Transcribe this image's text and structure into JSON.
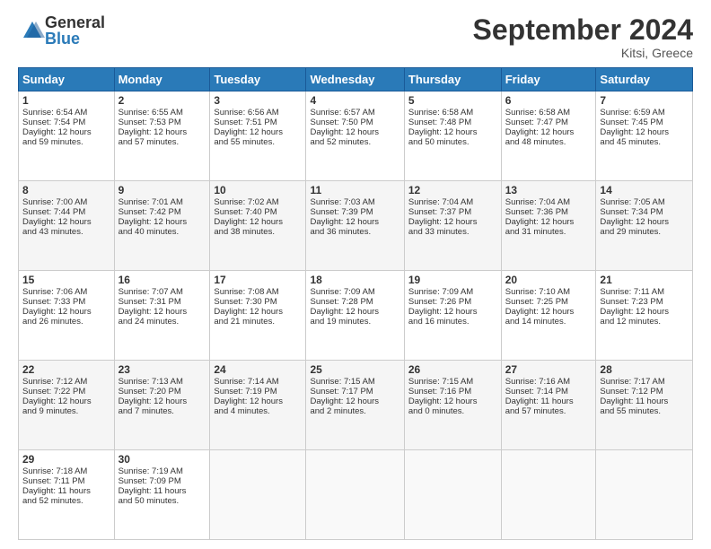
{
  "header": {
    "logo_general": "General",
    "logo_blue": "Blue",
    "month_title": "September 2024",
    "location": "Kitsi, Greece"
  },
  "days_of_week": [
    "Sunday",
    "Monday",
    "Tuesday",
    "Wednesday",
    "Thursday",
    "Friday",
    "Saturday"
  ],
  "weeks": [
    [
      {
        "day": "1",
        "lines": [
          "Sunrise: 6:54 AM",
          "Sunset: 7:54 PM",
          "Daylight: 12 hours",
          "and 59 minutes."
        ]
      },
      {
        "day": "2",
        "lines": [
          "Sunrise: 6:55 AM",
          "Sunset: 7:53 PM",
          "Daylight: 12 hours",
          "and 57 minutes."
        ]
      },
      {
        "day": "3",
        "lines": [
          "Sunrise: 6:56 AM",
          "Sunset: 7:51 PM",
          "Daylight: 12 hours",
          "and 55 minutes."
        ]
      },
      {
        "day": "4",
        "lines": [
          "Sunrise: 6:57 AM",
          "Sunset: 7:50 PM",
          "Daylight: 12 hours",
          "and 52 minutes."
        ]
      },
      {
        "day": "5",
        "lines": [
          "Sunrise: 6:58 AM",
          "Sunset: 7:48 PM",
          "Daylight: 12 hours",
          "and 50 minutes."
        ]
      },
      {
        "day": "6",
        "lines": [
          "Sunrise: 6:58 AM",
          "Sunset: 7:47 PM",
          "Daylight: 12 hours",
          "and 48 minutes."
        ]
      },
      {
        "day": "7",
        "lines": [
          "Sunrise: 6:59 AM",
          "Sunset: 7:45 PM",
          "Daylight: 12 hours",
          "and 45 minutes."
        ]
      }
    ],
    [
      {
        "day": "8",
        "lines": [
          "Sunrise: 7:00 AM",
          "Sunset: 7:44 PM",
          "Daylight: 12 hours",
          "and 43 minutes."
        ]
      },
      {
        "day": "9",
        "lines": [
          "Sunrise: 7:01 AM",
          "Sunset: 7:42 PM",
          "Daylight: 12 hours",
          "and 40 minutes."
        ]
      },
      {
        "day": "10",
        "lines": [
          "Sunrise: 7:02 AM",
          "Sunset: 7:40 PM",
          "Daylight: 12 hours",
          "and 38 minutes."
        ]
      },
      {
        "day": "11",
        "lines": [
          "Sunrise: 7:03 AM",
          "Sunset: 7:39 PM",
          "Daylight: 12 hours",
          "and 36 minutes."
        ]
      },
      {
        "day": "12",
        "lines": [
          "Sunrise: 7:04 AM",
          "Sunset: 7:37 PM",
          "Daylight: 12 hours",
          "and 33 minutes."
        ]
      },
      {
        "day": "13",
        "lines": [
          "Sunrise: 7:04 AM",
          "Sunset: 7:36 PM",
          "Daylight: 12 hours",
          "and 31 minutes."
        ]
      },
      {
        "day": "14",
        "lines": [
          "Sunrise: 7:05 AM",
          "Sunset: 7:34 PM",
          "Daylight: 12 hours",
          "and 29 minutes."
        ]
      }
    ],
    [
      {
        "day": "15",
        "lines": [
          "Sunrise: 7:06 AM",
          "Sunset: 7:33 PM",
          "Daylight: 12 hours",
          "and 26 minutes."
        ]
      },
      {
        "day": "16",
        "lines": [
          "Sunrise: 7:07 AM",
          "Sunset: 7:31 PM",
          "Daylight: 12 hours",
          "and 24 minutes."
        ]
      },
      {
        "day": "17",
        "lines": [
          "Sunrise: 7:08 AM",
          "Sunset: 7:30 PM",
          "Daylight: 12 hours",
          "and 21 minutes."
        ]
      },
      {
        "day": "18",
        "lines": [
          "Sunrise: 7:09 AM",
          "Sunset: 7:28 PM",
          "Daylight: 12 hours",
          "and 19 minutes."
        ]
      },
      {
        "day": "19",
        "lines": [
          "Sunrise: 7:09 AM",
          "Sunset: 7:26 PM",
          "Daylight: 12 hours",
          "and 16 minutes."
        ]
      },
      {
        "day": "20",
        "lines": [
          "Sunrise: 7:10 AM",
          "Sunset: 7:25 PM",
          "Daylight: 12 hours",
          "and 14 minutes."
        ]
      },
      {
        "day": "21",
        "lines": [
          "Sunrise: 7:11 AM",
          "Sunset: 7:23 PM",
          "Daylight: 12 hours",
          "and 12 minutes."
        ]
      }
    ],
    [
      {
        "day": "22",
        "lines": [
          "Sunrise: 7:12 AM",
          "Sunset: 7:22 PM",
          "Daylight: 12 hours",
          "and 9 minutes."
        ]
      },
      {
        "day": "23",
        "lines": [
          "Sunrise: 7:13 AM",
          "Sunset: 7:20 PM",
          "Daylight: 12 hours",
          "and 7 minutes."
        ]
      },
      {
        "day": "24",
        "lines": [
          "Sunrise: 7:14 AM",
          "Sunset: 7:19 PM",
          "Daylight: 12 hours",
          "and 4 minutes."
        ]
      },
      {
        "day": "25",
        "lines": [
          "Sunrise: 7:15 AM",
          "Sunset: 7:17 PM",
          "Daylight: 12 hours",
          "and 2 minutes."
        ]
      },
      {
        "day": "26",
        "lines": [
          "Sunrise: 7:15 AM",
          "Sunset: 7:16 PM",
          "Daylight: 12 hours",
          "and 0 minutes."
        ]
      },
      {
        "day": "27",
        "lines": [
          "Sunrise: 7:16 AM",
          "Sunset: 7:14 PM",
          "Daylight: 11 hours",
          "and 57 minutes."
        ]
      },
      {
        "day": "28",
        "lines": [
          "Sunrise: 7:17 AM",
          "Sunset: 7:12 PM",
          "Daylight: 11 hours",
          "and 55 minutes."
        ]
      }
    ],
    [
      {
        "day": "29",
        "lines": [
          "Sunrise: 7:18 AM",
          "Sunset: 7:11 PM",
          "Daylight: 11 hours",
          "and 52 minutes."
        ]
      },
      {
        "day": "30",
        "lines": [
          "Sunrise: 7:19 AM",
          "Sunset: 7:09 PM",
          "Daylight: 11 hours",
          "and 50 minutes."
        ]
      },
      {
        "day": "",
        "lines": []
      },
      {
        "day": "",
        "lines": []
      },
      {
        "day": "",
        "lines": []
      },
      {
        "day": "",
        "lines": []
      },
      {
        "day": "",
        "lines": []
      }
    ]
  ]
}
